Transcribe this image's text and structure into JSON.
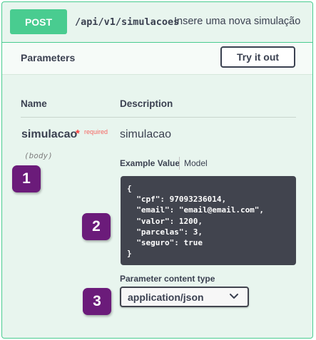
{
  "operation": {
    "method": "POST",
    "path": "/api/v1/simulacoes",
    "summary": "Insere uma nova simulação",
    "colors": {
      "accent": "#49cc90",
      "background": "#e8f5ee",
      "text": "#3b4151"
    }
  },
  "parameters_section": {
    "title": "Parameters",
    "try_it_out_label": "Try it out"
  },
  "table": {
    "name_header": "Name",
    "description_header": "Description"
  },
  "parameter": {
    "name": "simulacao",
    "required_marker": "*",
    "required_label": "required",
    "location": "(body)",
    "description": "simulacao"
  },
  "example_tabs": {
    "example_label": "Example Value",
    "model_label": "Model"
  },
  "example_code": "{\n  \"cpf\": 97093236014,\n  \"email\": \"email@email.com\",\n  \"valor\": 1200,\n  \"parcelas\": 3,\n  \"seguro\": true\n}",
  "content_type": {
    "label": "Parameter content type",
    "selected": "application/json",
    "icon": "chevron-down-icon"
  },
  "annotations": {
    "badge_1": "1",
    "badge_2": "2",
    "badge_3": "3",
    "color": "#6b1b7a"
  }
}
